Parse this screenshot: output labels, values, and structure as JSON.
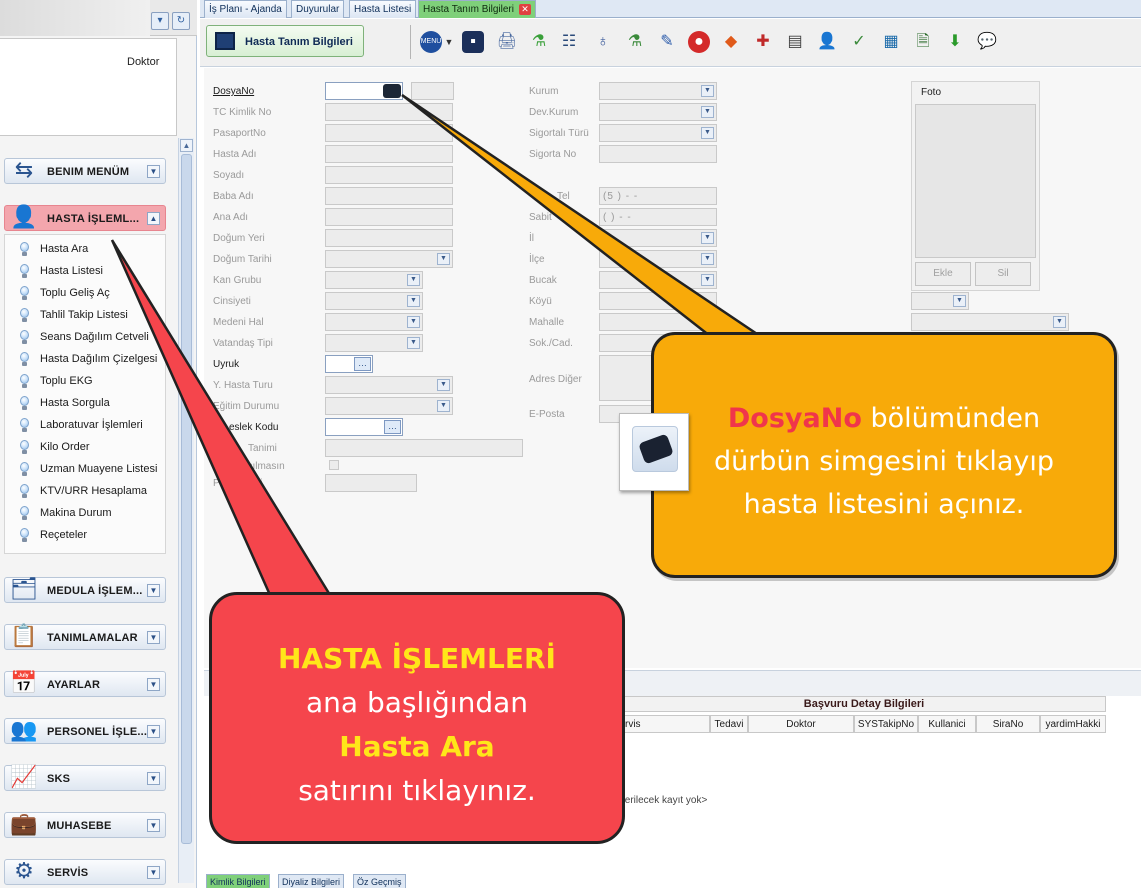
{
  "doctor_label": "Doktor",
  "menu_groups": [
    {
      "label": "BENIM MENÜM",
      "icon": "refresh-arrows-icon"
    },
    {
      "label": "HASTA İŞLEML...",
      "icon": "patient-icon"
    },
    {
      "label": "MEDULA İŞLEM...",
      "icon": "folder-icon"
    },
    {
      "label": "TANIMLAMALAR",
      "icon": "checklist-icon"
    },
    {
      "label": "AYARLAR",
      "icon": "calendar-clock-icon"
    },
    {
      "label": "PERSONEL İŞLE...",
      "icon": "staff-icon"
    },
    {
      "label": "SKS",
      "icon": "pulse-icon"
    },
    {
      "label": "MUHASEBE",
      "icon": "briefcase-icon"
    },
    {
      "label": "SERVİS",
      "icon": "gear-icon"
    }
  ],
  "hasta_items": [
    "Hasta Ara",
    "Hasta Listesi",
    "Toplu Geliş Aç",
    "Tahlil Takip Listesi",
    "Seans Dağılım Cetveli",
    "Hasta Dağılım Çizelgesi",
    "Toplu EKG",
    "Hasta Sorgula",
    "Laboratuvar İşlemleri",
    "Kilo Order",
    "Uzman Muayene Listesi",
    "KTV/URR Hesaplama",
    "Makina Durum",
    "Reçeteler"
  ],
  "tabs": [
    "İş Planı - Ajanda",
    "Duyurular",
    "Hasta Listesi",
    "Hasta Tanım Bilgileri"
  ],
  "page_tab": "Hasta Tanım Bilgileri",
  "form_left": {
    "dosya_no": "DosyaNo",
    "tc": "TC Kimlik No",
    "pasaport": "PasaportNo",
    "ad": "Hasta Adı",
    "soyad": "Soyadı",
    "baba": "Baba Adı",
    "ana": "Ana Adı",
    "dogum_yeri": "Doğum Yeri",
    "dogum_tarihi": "Doğum Tarihi",
    "kan": "Kan Grubu",
    "cinsiyet": "Cinsiyeti",
    "medeni": "Medeni Hal",
    "vatandas": "Vatandaş Tipi",
    "uyruk": "Uyruk",
    "hasta_turu": "Y. Hasta Turu",
    "egitim": "Eğitim Durumu",
    "meslek_kodu": "eslek Kodu",
    "meslek_tanimi": "Tanimi",
    "paylasim": "B   Paylaşılmasın",
    "paylasilacak": "Pay    ak Kişi"
  },
  "form_mid": {
    "kurum": "Kurum",
    "dev_kurum": "Dev.Kurum",
    "sigorta_turu": "Sigortalı Türü",
    "sigorta_no": "Sigorta No",
    "cep": "Tel",
    "sabit": "Sabit",
    "il": "İl",
    "ilce": "İlçe",
    "bucak": "Bucak",
    "koy": "Köyü",
    "mahalle": "Mahalle",
    "sokak": "Sok./Cad.",
    "adres": "Adres Diğer",
    "eposta": "E-Posta",
    "cep_mask": "(5 )  -  -",
    "sabit_mask": "(  )  -  -"
  },
  "foto": {
    "title": "Foto",
    "ekle": "Ekle",
    "sil": "Sil"
  },
  "grid": {
    "title": "Başvuru Detay Bilgileri",
    "columns": [
      "rvis",
      "Tedavi",
      "Doktor",
      "SYSTakipNo",
      "Kullanici",
      "SiraNo",
      "yardimHakki"
    ],
    "empty": "terilecek kayıt yok>"
  },
  "bottom_tabs": [
    "Kimlik Bilgileri",
    "Diyaliz Bilgileri",
    "Öz Geçmiş"
  ],
  "callout_orange": {
    "hl": "DosyaNo",
    "line1": " bölümünden",
    "line2": "dürbün simgesini tıklayıp",
    "line3": "hasta listesini açınız."
  },
  "callout_red": {
    "hl1": "HASTA İŞLEMLERİ",
    "line2": "ana başlığından",
    "hl2": "Hasta Ara",
    "line4": "satırını tıklayınız."
  },
  "colors": {
    "orange_callout": "#f8aa09",
    "red_callout": "#f5454c",
    "highlight_red": "#f0354b",
    "highlight_yellow": "#ffe619",
    "active_tab": "#7fd07a"
  }
}
